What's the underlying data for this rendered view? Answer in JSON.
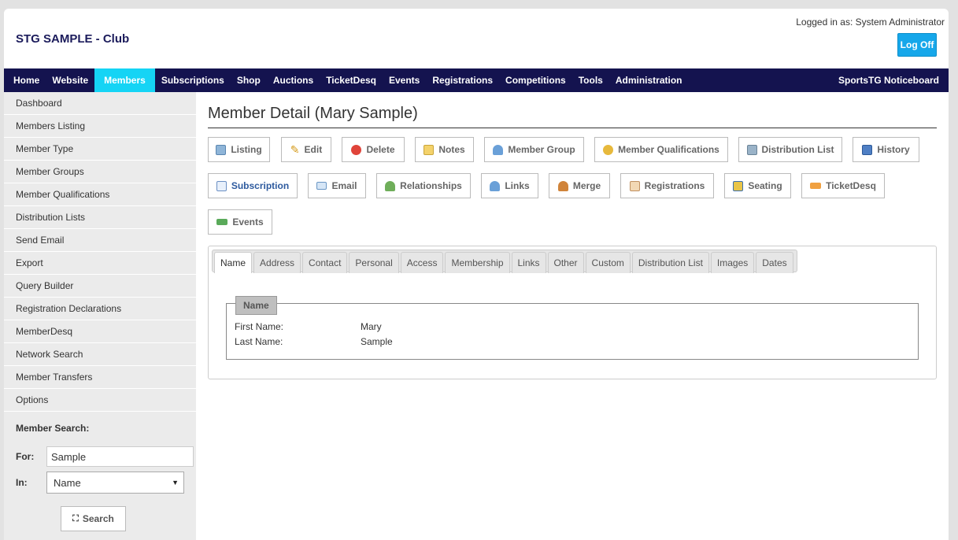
{
  "header": {
    "site_title": "STG SAMPLE - Club",
    "login_text": "Logged in as: System Administrator",
    "logoff_label": "Log Off"
  },
  "nav": {
    "items": [
      "Home",
      "Website",
      "Members",
      "Subscriptions",
      "Shop",
      "Auctions",
      "TicketDesq",
      "Events",
      "Registrations",
      "Competitions",
      "Tools",
      "Administration"
    ],
    "active": "Members",
    "right": "SportsTG Noticeboard"
  },
  "sidebar": {
    "items": [
      "Dashboard",
      "Members Listing",
      "Member Type",
      "Member Groups",
      "Member Qualifications",
      "Distribution Lists",
      "Send Email",
      "Export",
      "Query Builder",
      "Registration Declarations",
      "MemberDesq",
      "Network Search",
      "Member Transfers",
      "Options"
    ],
    "search": {
      "title": "Member Search:",
      "for_label": "For:",
      "for_value": "Sample",
      "in_label": "In:",
      "in_value": "Name",
      "button": "Search"
    }
  },
  "main": {
    "title": "Member Detail (Mary Sample)",
    "buttons": {
      "listing": "Listing",
      "edit": "Edit",
      "delete": "Delete",
      "notes": "Notes",
      "member_group": "Member Group",
      "member_qualifications": "Member Qualifications",
      "distribution_list": "Distribution List",
      "history": "History",
      "subscription": "Subscription",
      "email": "Email",
      "relationships": "Relationships",
      "links": "Links",
      "merge": "Merge",
      "registrations": "Registrations",
      "seating": "Seating",
      "ticketdesq": "TicketDesq",
      "events": "Events"
    },
    "tabs": [
      "Name",
      "Address",
      "Contact",
      "Personal",
      "Access",
      "Membership",
      "Links",
      "Other",
      "Custom",
      "Distribution List",
      "Images",
      "Dates"
    ],
    "active_tab": "Name",
    "fieldset": {
      "legend": "Name",
      "first_name_label": "First Name:",
      "first_name_value": "Mary",
      "last_name_label": "Last Name:",
      "last_name_value": "Sample"
    }
  },
  "colors": {
    "nav_bg": "#14134f",
    "nav_active": "#15d4f5",
    "logoff_bg": "#16a7ea"
  }
}
